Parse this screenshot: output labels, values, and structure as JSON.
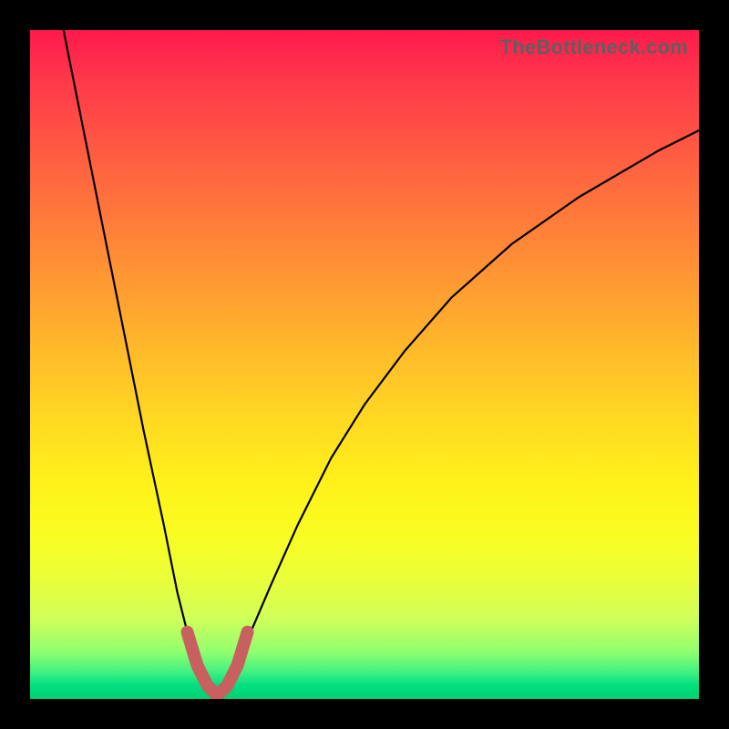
{
  "watermark": "TheBottleneck.com",
  "chart_data": {
    "type": "line",
    "title": "",
    "xlabel": "",
    "ylabel": "",
    "xlim": [
      0,
      100
    ],
    "ylim": [
      0,
      100
    ],
    "series": [
      {
        "name": "bottleneck-curve",
        "x": [
          5,
          8,
          11,
          14,
          17,
          20,
          22,
          23.5,
          25,
          26.5,
          28,
          29.5,
          31,
          33,
          36,
          40,
          45,
          50,
          56,
          63,
          72,
          82,
          94,
          100
        ],
        "y": [
          100,
          85,
          70,
          55,
          40,
          26,
          16,
          10,
          5,
          2,
          0.5,
          2,
          5,
          10,
          17,
          26,
          36,
          44,
          52,
          60,
          68,
          75,
          82,
          85
        ]
      },
      {
        "name": "highlight-region",
        "x": [
          23.5,
          25,
          26.5,
          28,
          29.5,
          31,
          32.5
        ],
        "y": [
          10,
          5,
          2,
          0.5,
          2,
          5,
          10
        ]
      }
    ],
    "colors": {
      "curve": "#000000",
      "highlight": "#c86060"
    },
    "notes": "V-shaped bottleneck curve over red-yellow-green vertical gradient; minimum near x≈28. Pink thick segment marks the valley floor. No axis ticks or labels are rendered."
  }
}
